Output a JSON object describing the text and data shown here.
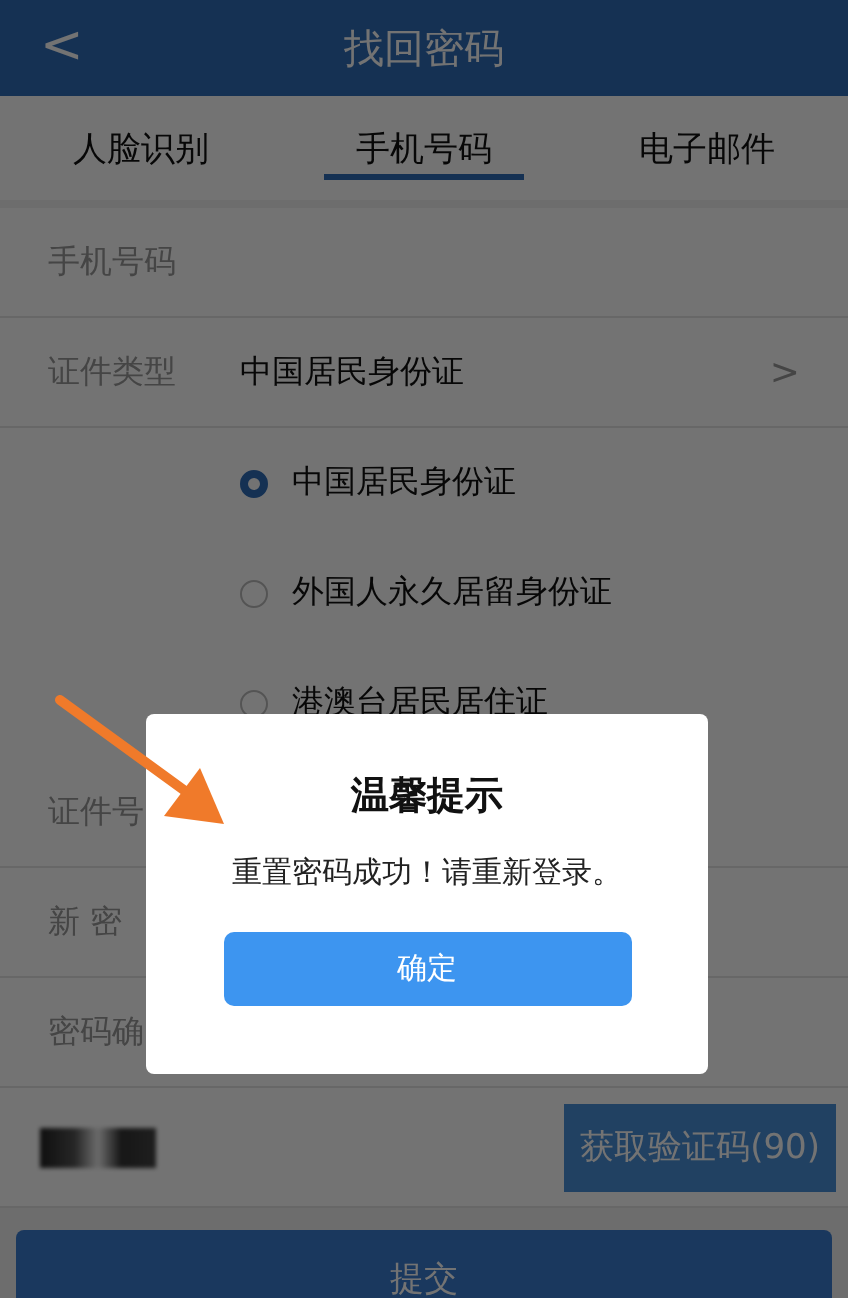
{
  "header": {
    "back": "<",
    "title": "找回密码"
  },
  "tabs": [
    {
      "label": "人脸识别",
      "selected": false
    },
    {
      "label": "手机号码",
      "selected": true
    },
    {
      "label": "电子邮件",
      "selected": false
    }
  ],
  "form": {
    "rows": [
      {
        "kind": "field",
        "label": "手机号码"
      },
      {
        "kind": "select",
        "label": "证件类型",
        "value": "中国居民身份证",
        "chevron": ">"
      },
      {
        "kind": "option",
        "label": "中国居民身份证",
        "selected": true
      },
      {
        "kind": "option",
        "label": "外国人永久居留身份证",
        "selected": false
      },
      {
        "kind": "option",
        "label": "港澳台居民居住证",
        "selected": false
      },
      {
        "kind": "field",
        "label": "证件号"
      },
      {
        "kind": "field",
        "label": "新 密"
      },
      {
        "kind": "field",
        "label": "密码确"
      },
      {
        "kind": "code",
        "button": "获取验证码(90)"
      }
    ],
    "submit": "提交"
  },
  "dialog": {
    "title": "温馨提示",
    "message": "重置密码成功！请重新登录。",
    "button": "确定"
  },
  "annotation": {
    "kind": "arrow"
  }
}
